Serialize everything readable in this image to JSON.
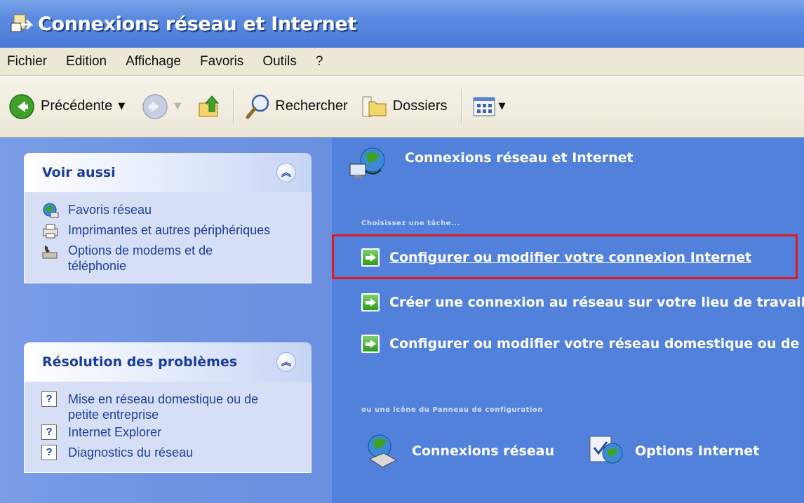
{
  "window": {
    "title": "Connexions réseau et Internet"
  },
  "menu": [
    "Fichier",
    "Edition",
    "Affichage",
    "Favoris",
    "Outils",
    "?"
  ],
  "toolbar": {
    "back_label": "Précédente",
    "search_label": "Rechercher",
    "folders_label": "Dossiers"
  },
  "see_also": {
    "title": "Voir aussi",
    "links": [
      "Favoris réseau",
      "Imprimantes et autres périphériques",
      "Options de modems et de téléphonie"
    ]
  },
  "troubleshoot": {
    "title": "Résolution des problèmes",
    "links": [
      "Mise en réseau domestique ou de petite entreprise",
      "Internet Explorer",
      "Diagnostics du réseau"
    ]
  },
  "main": {
    "title": "Connexions réseau et Internet",
    "choose_task": "Choisissez une tâche...",
    "tasks": [
      "Configurer ou modifier votre connexion Internet",
      "Créer une connexion au réseau sur votre lieu de travail",
      "Configurer ou modifier votre réseau domestique ou de petite entreprise"
    ],
    "or_pick": "ou une icône du Panneau de configuration",
    "cp_icons": [
      "Connexions réseau",
      "Options Internet"
    ]
  },
  "colors": {
    "highlight": "#e01a1a",
    "content_bg": "#5281dc",
    "title_bar": "#4a7ad8"
  }
}
